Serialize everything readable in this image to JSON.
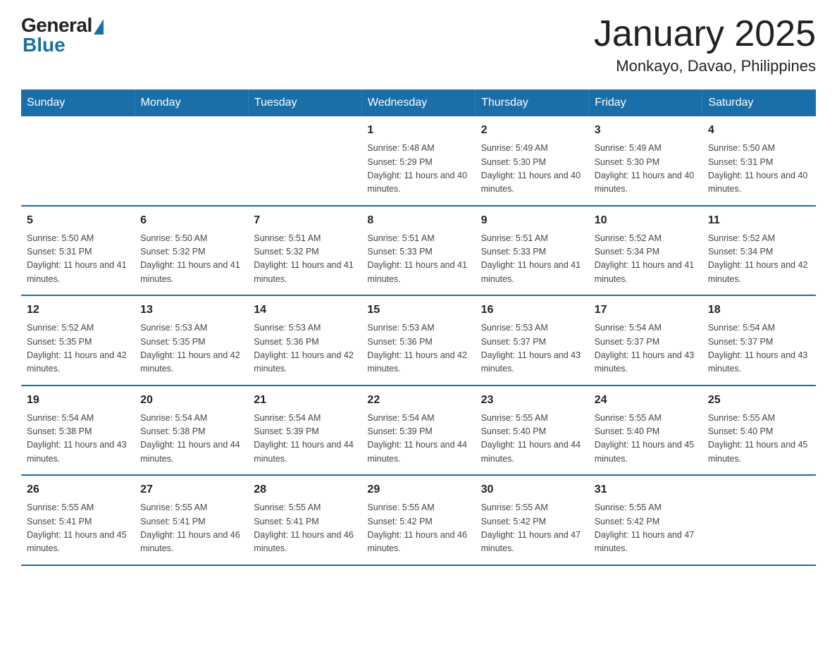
{
  "header": {
    "logo_general": "General",
    "logo_blue": "Blue",
    "month_title": "January 2025",
    "location": "Monkayo, Davao, Philippines"
  },
  "weekdays": [
    "Sunday",
    "Monday",
    "Tuesday",
    "Wednesday",
    "Thursday",
    "Friday",
    "Saturday"
  ],
  "weeks": [
    [
      {
        "day": "",
        "info": ""
      },
      {
        "day": "",
        "info": ""
      },
      {
        "day": "",
        "info": ""
      },
      {
        "day": "1",
        "info": "Sunrise: 5:48 AM\nSunset: 5:29 PM\nDaylight: 11 hours and 40 minutes."
      },
      {
        "day": "2",
        "info": "Sunrise: 5:49 AM\nSunset: 5:30 PM\nDaylight: 11 hours and 40 minutes."
      },
      {
        "day": "3",
        "info": "Sunrise: 5:49 AM\nSunset: 5:30 PM\nDaylight: 11 hours and 40 minutes."
      },
      {
        "day": "4",
        "info": "Sunrise: 5:50 AM\nSunset: 5:31 PM\nDaylight: 11 hours and 40 minutes."
      }
    ],
    [
      {
        "day": "5",
        "info": "Sunrise: 5:50 AM\nSunset: 5:31 PM\nDaylight: 11 hours and 41 minutes."
      },
      {
        "day": "6",
        "info": "Sunrise: 5:50 AM\nSunset: 5:32 PM\nDaylight: 11 hours and 41 minutes."
      },
      {
        "day": "7",
        "info": "Sunrise: 5:51 AM\nSunset: 5:32 PM\nDaylight: 11 hours and 41 minutes."
      },
      {
        "day": "8",
        "info": "Sunrise: 5:51 AM\nSunset: 5:33 PM\nDaylight: 11 hours and 41 minutes."
      },
      {
        "day": "9",
        "info": "Sunrise: 5:51 AM\nSunset: 5:33 PM\nDaylight: 11 hours and 41 minutes."
      },
      {
        "day": "10",
        "info": "Sunrise: 5:52 AM\nSunset: 5:34 PM\nDaylight: 11 hours and 41 minutes."
      },
      {
        "day": "11",
        "info": "Sunrise: 5:52 AM\nSunset: 5:34 PM\nDaylight: 11 hours and 42 minutes."
      }
    ],
    [
      {
        "day": "12",
        "info": "Sunrise: 5:52 AM\nSunset: 5:35 PM\nDaylight: 11 hours and 42 minutes."
      },
      {
        "day": "13",
        "info": "Sunrise: 5:53 AM\nSunset: 5:35 PM\nDaylight: 11 hours and 42 minutes."
      },
      {
        "day": "14",
        "info": "Sunrise: 5:53 AM\nSunset: 5:36 PM\nDaylight: 11 hours and 42 minutes."
      },
      {
        "day": "15",
        "info": "Sunrise: 5:53 AM\nSunset: 5:36 PM\nDaylight: 11 hours and 42 minutes."
      },
      {
        "day": "16",
        "info": "Sunrise: 5:53 AM\nSunset: 5:37 PM\nDaylight: 11 hours and 43 minutes."
      },
      {
        "day": "17",
        "info": "Sunrise: 5:54 AM\nSunset: 5:37 PM\nDaylight: 11 hours and 43 minutes."
      },
      {
        "day": "18",
        "info": "Sunrise: 5:54 AM\nSunset: 5:37 PM\nDaylight: 11 hours and 43 minutes."
      }
    ],
    [
      {
        "day": "19",
        "info": "Sunrise: 5:54 AM\nSunset: 5:38 PM\nDaylight: 11 hours and 43 minutes."
      },
      {
        "day": "20",
        "info": "Sunrise: 5:54 AM\nSunset: 5:38 PM\nDaylight: 11 hours and 44 minutes."
      },
      {
        "day": "21",
        "info": "Sunrise: 5:54 AM\nSunset: 5:39 PM\nDaylight: 11 hours and 44 minutes."
      },
      {
        "day": "22",
        "info": "Sunrise: 5:54 AM\nSunset: 5:39 PM\nDaylight: 11 hours and 44 minutes."
      },
      {
        "day": "23",
        "info": "Sunrise: 5:55 AM\nSunset: 5:40 PM\nDaylight: 11 hours and 44 minutes."
      },
      {
        "day": "24",
        "info": "Sunrise: 5:55 AM\nSunset: 5:40 PM\nDaylight: 11 hours and 45 minutes."
      },
      {
        "day": "25",
        "info": "Sunrise: 5:55 AM\nSunset: 5:40 PM\nDaylight: 11 hours and 45 minutes."
      }
    ],
    [
      {
        "day": "26",
        "info": "Sunrise: 5:55 AM\nSunset: 5:41 PM\nDaylight: 11 hours and 45 minutes."
      },
      {
        "day": "27",
        "info": "Sunrise: 5:55 AM\nSunset: 5:41 PM\nDaylight: 11 hours and 46 minutes."
      },
      {
        "day": "28",
        "info": "Sunrise: 5:55 AM\nSunset: 5:41 PM\nDaylight: 11 hours and 46 minutes."
      },
      {
        "day": "29",
        "info": "Sunrise: 5:55 AM\nSunset: 5:42 PM\nDaylight: 11 hours and 46 minutes."
      },
      {
        "day": "30",
        "info": "Sunrise: 5:55 AM\nSunset: 5:42 PM\nDaylight: 11 hours and 47 minutes."
      },
      {
        "day": "31",
        "info": "Sunrise: 5:55 AM\nSunset: 5:42 PM\nDaylight: 11 hours and 47 minutes."
      },
      {
        "day": "",
        "info": ""
      }
    ]
  ]
}
